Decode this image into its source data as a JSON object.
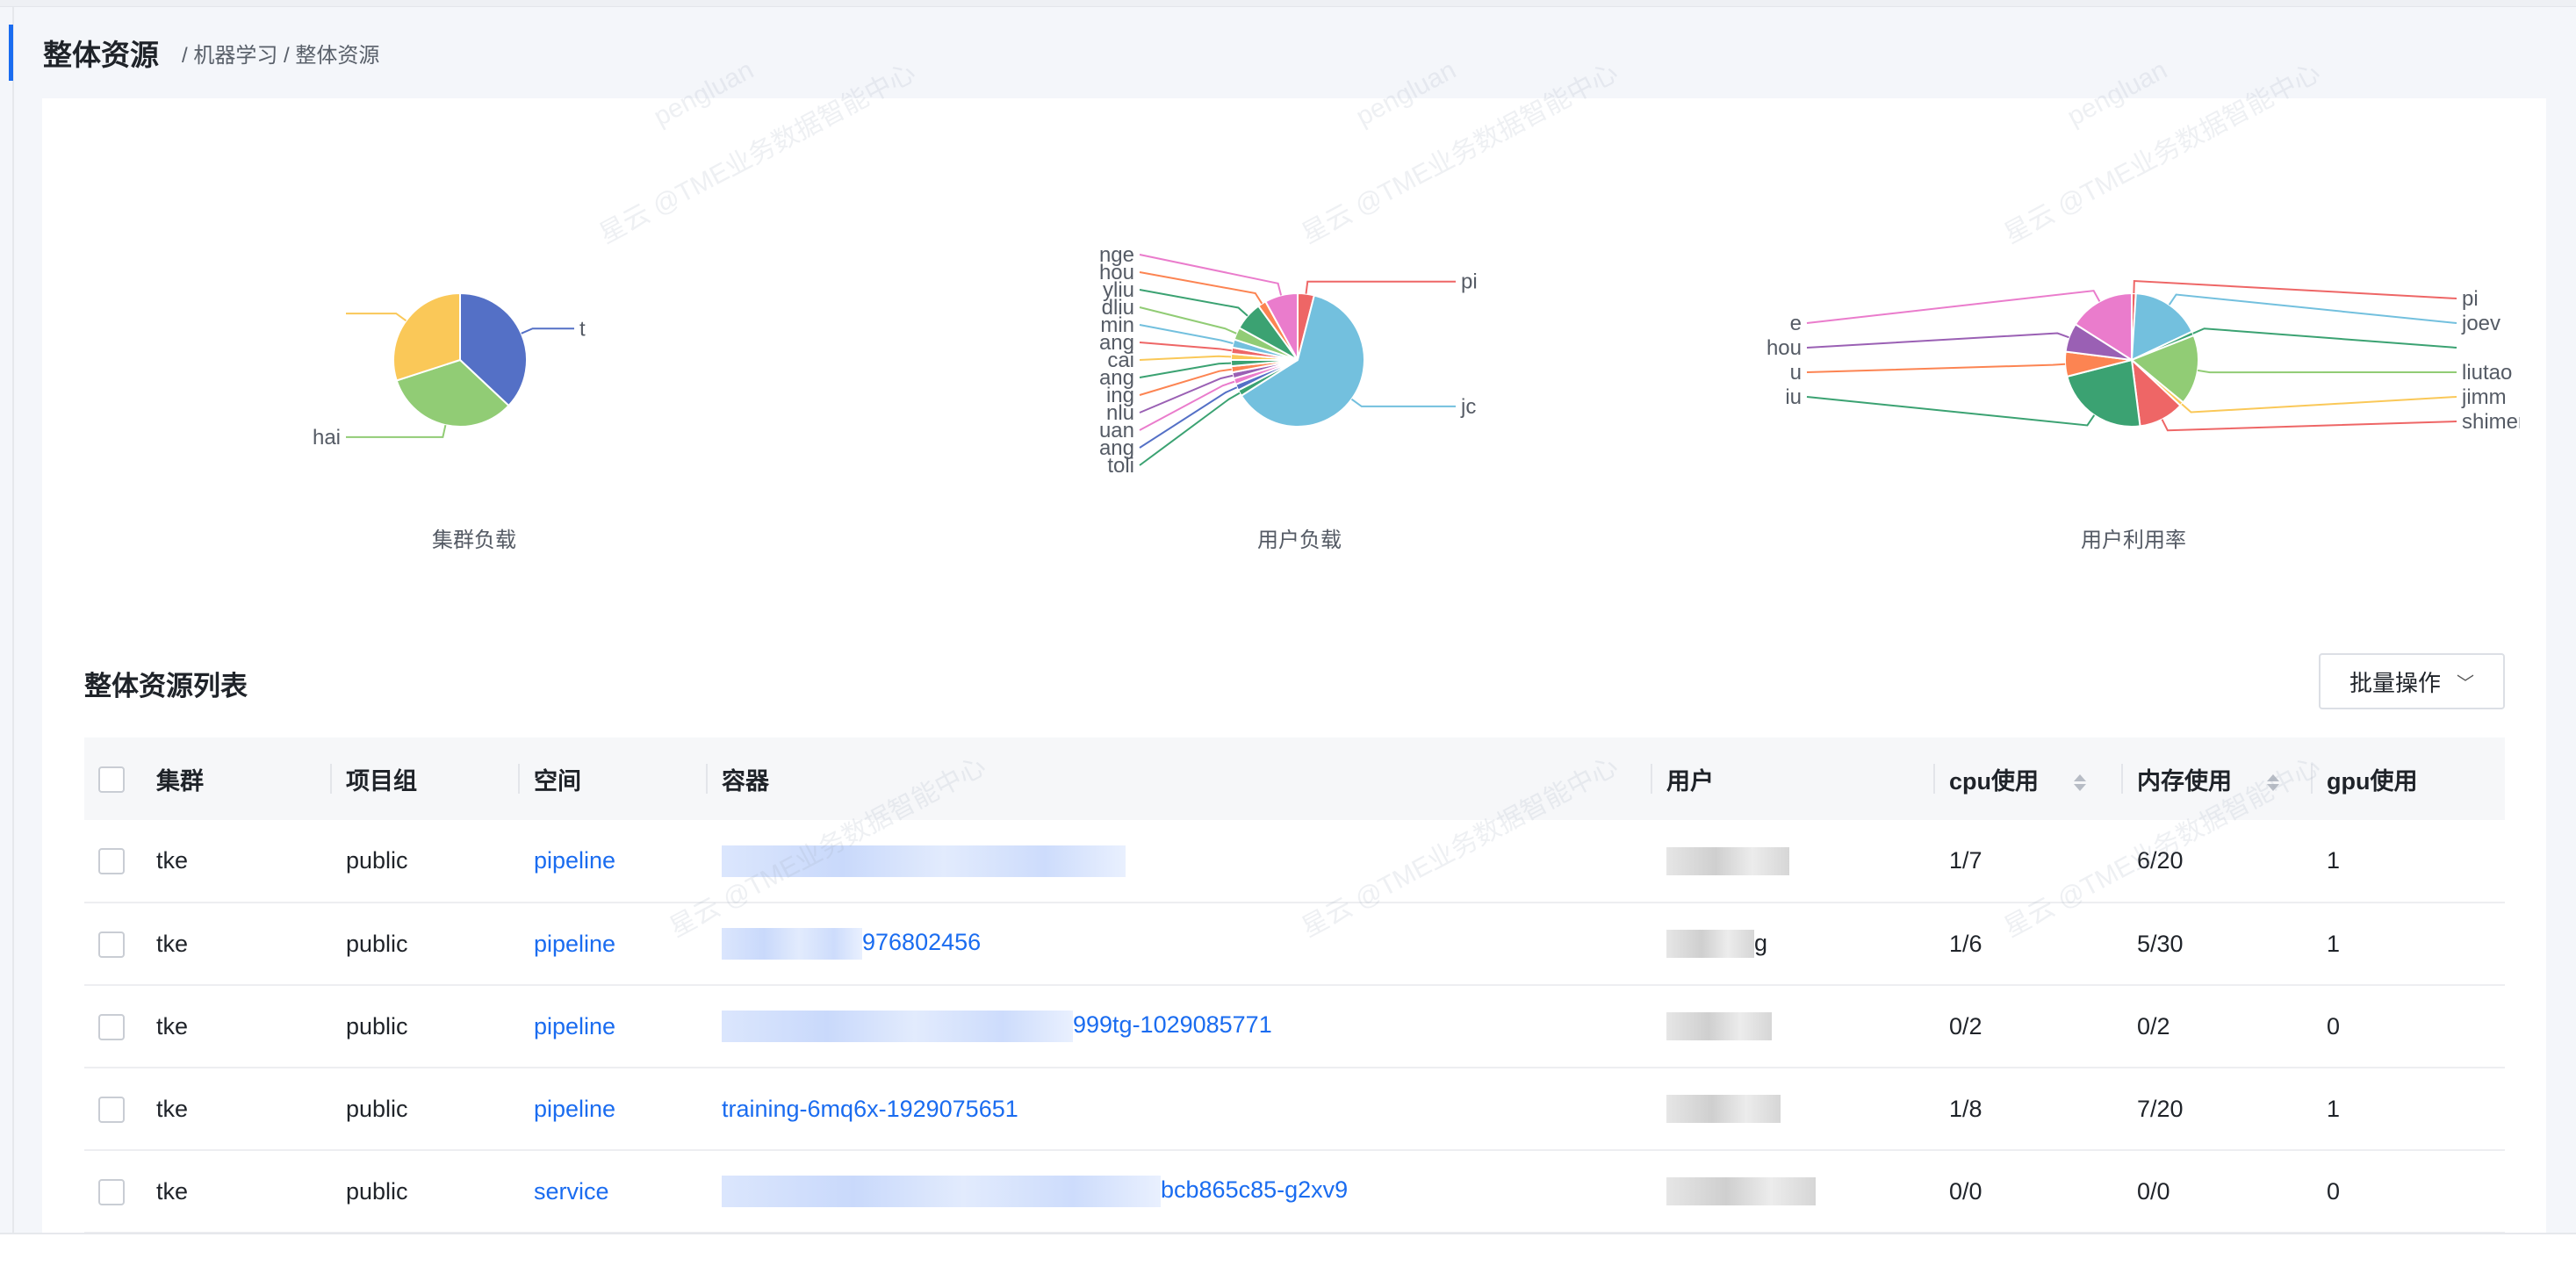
{
  "page": {
    "title": "整体资源",
    "breadcrumb": "/ 机器学习 / 整体资源"
  },
  "charts": [
    {
      "caption": "集群负载",
      "chart_data": {
        "type": "pie",
        "slices": [
          {
            "label": "t",
            "value": 37,
            "color": "#5470c6"
          },
          {
            "label": "hai",
            "value": 33,
            "color": "#91cc75"
          },
          {
            "label": "",
            "value": 30,
            "color": "#fac858"
          }
        ]
      }
    },
    {
      "caption": "用户负载",
      "chart_data": {
        "type": "pie",
        "slices": [
          {
            "label": "pi",
            "value": 4,
            "color": "#ee6666"
          },
          {
            "label": "jc",
            "value": 62,
            "color": "#73c0de"
          },
          {
            "label": "toli",
            "value": 1.5,
            "color": "#3ba272"
          },
          {
            "label": "ang",
            "value": 1.5,
            "color": "#5470c6"
          },
          {
            "label": "uan",
            "value": 1.5,
            "color": "#ea7ccc"
          },
          {
            "label": "nlu",
            "value": 1.5,
            "color": "#9a60b4"
          },
          {
            "label": "ing",
            "value": 1.5,
            "color": "#fc8452"
          },
          {
            "label": "ang",
            "value": 1.5,
            "color": "#3ba272"
          },
          {
            "label": "cai",
            "value": 1.5,
            "color": "#fac858"
          },
          {
            "label": "ang",
            "value": 1.5,
            "color": "#ee6666"
          },
          {
            "label": "min",
            "value": 2,
            "color": "#73c0de"
          },
          {
            "label": "dliu",
            "value": 3,
            "color": "#91cc75"
          },
          {
            "label": "yliu",
            "value": 7,
            "color": "#3ba272"
          },
          {
            "label": "hou",
            "value": 2,
            "color": "#fc8452"
          },
          {
            "label": "nge",
            "value": 8,
            "color": "#ea7ccc"
          }
        ]
      }
    },
    {
      "caption": "用户利用率",
      "chart_data": {
        "type": "pie",
        "slices": [
          {
            "label": "pi",
            "value": 1,
            "color": "#ee6666"
          },
          {
            "label": "joev",
            "value": 17,
            "color": "#73c0de"
          },
          {
            "label": "",
            "value": 1,
            "color": "#3ba272"
          },
          {
            "label": "liutao",
            "value": 17,
            "color": "#91cc75"
          },
          {
            "label": "jimm",
            "value": 1,
            "color": "#fac858"
          },
          {
            "label": "shimen",
            "value": 11,
            "color": "#ee6666"
          },
          {
            "label": "iu",
            "value": 23,
            "color": "#3ba272"
          },
          {
            "label": "u",
            "value": 6,
            "color": "#fc8452"
          },
          {
            "label": "hou",
            "value": 7,
            "color": "#9a60b4"
          },
          {
            "label": "e",
            "value": 16,
            "color": "#ea7ccc"
          }
        ]
      }
    }
  ],
  "list": {
    "title": "整体资源列表",
    "batch_button": "批量操作",
    "columns": [
      "集群",
      "项目组",
      "空间",
      "容器",
      "用户",
      "cpu使用",
      "内存使用",
      "gpu使用"
    ],
    "rows": [
      {
        "cluster": "tke",
        "group": "public",
        "space": "pipeline",
        "container": "",
        "user": "",
        "cpu": "1/7",
        "mem": "6/20",
        "gpu": "1"
      },
      {
        "cluster": "tke",
        "group": "public",
        "space": "pipeline",
        "container": "976802456",
        "user": "g",
        "cpu": "1/6",
        "mem": "5/30",
        "gpu": "1"
      },
      {
        "cluster": "tke",
        "group": "public",
        "space": "pipeline",
        "container": "999tg-1029085771",
        "user": "",
        "cpu": "0/2",
        "mem": "0/2",
        "gpu": "0"
      },
      {
        "cluster": "tke",
        "group": "public",
        "space": "pipeline",
        "container": "training-6mq6x-1929075651",
        "user": "",
        "cpu": "1/8",
        "mem": "7/20",
        "gpu": "1"
      },
      {
        "cluster": "tke",
        "group": "public",
        "space": "service",
        "container": "bcb865c85-g2xv9",
        "user": "",
        "cpu": "0/0",
        "mem": "0/0",
        "gpu": "0"
      }
    ]
  },
  "watermark": {
    "text": "星云 @TME业务数据智能中心",
    "user": "pengluan"
  }
}
